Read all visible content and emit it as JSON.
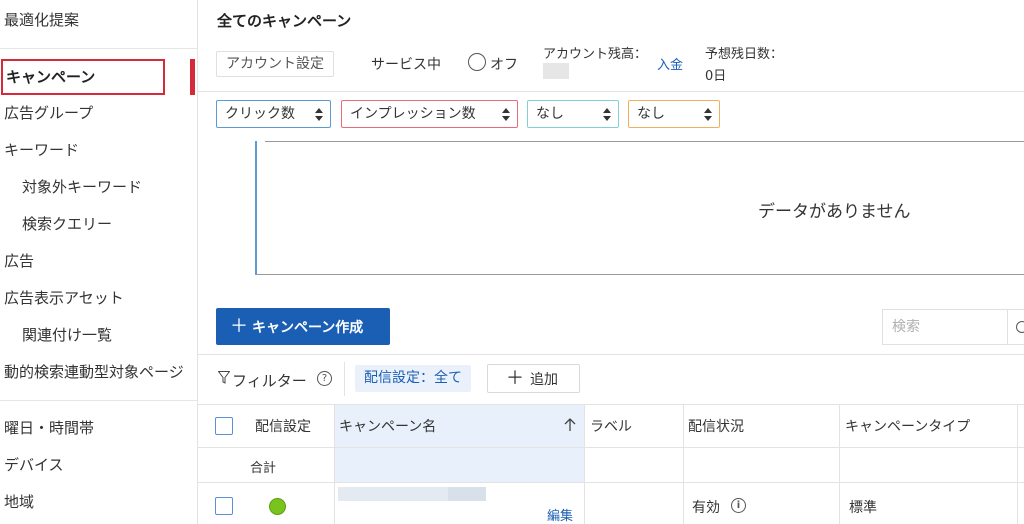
{
  "sidebar": {
    "items": [
      {
        "label": "最適化提案"
      },
      {
        "label": "キャンペーン"
      },
      {
        "label": "広告グループ"
      },
      {
        "label": "キーワード"
      },
      {
        "label": "対象外キーワード"
      },
      {
        "label": "検索クエリー"
      },
      {
        "label": "広告"
      },
      {
        "label": "広告表示アセット"
      },
      {
        "label": "関連付け一覧"
      },
      {
        "label": "動的検索連動型対象ページ"
      },
      {
        "label": "曜日・時間帯"
      },
      {
        "label": "デバイス"
      },
      {
        "label": "地域"
      }
    ]
  },
  "header": {
    "title": "全てのキャンペーン",
    "account_setting": "アカウント設定",
    "service_status": "サービス中",
    "toggle_label": "オフ",
    "balance_label": "アカウント残高：",
    "deposit_link": "入金",
    "days_label": "予想残日数：",
    "days_value": "0日"
  },
  "metrics": [
    {
      "label": "クリック数",
      "color": "#5b9bd5"
    },
    {
      "label": "インプレッション数",
      "color": "#e86b7a"
    },
    {
      "label": "なし",
      "color": "#7fd1d6"
    },
    {
      "label": "なし",
      "color": "#f0b060"
    }
  ],
  "chart": {
    "empty_message": "データがありません"
  },
  "toolbar": {
    "create_label": "キャンペーン作成",
    "search_placeholder": "検索"
  },
  "filter": {
    "label": "フィルター",
    "chip": "配信設定：全て",
    "add_label": "追加"
  },
  "table": {
    "columns": [
      "配信設定",
      "キャンペーン名",
      "ラベル",
      "配信状況",
      "キャンペーンタイプ"
    ],
    "total_label": "合計",
    "rows": [
      {
        "delivery_status": "有効",
        "campaign_type": "標準",
        "edit": "編集"
      }
    ]
  },
  "icons": {
    "sort": "arrow-up-icon",
    "status": "green-dot",
    "filter": "funnel-icon",
    "help": "question-circle-icon",
    "info": "info-circle-icon"
  }
}
